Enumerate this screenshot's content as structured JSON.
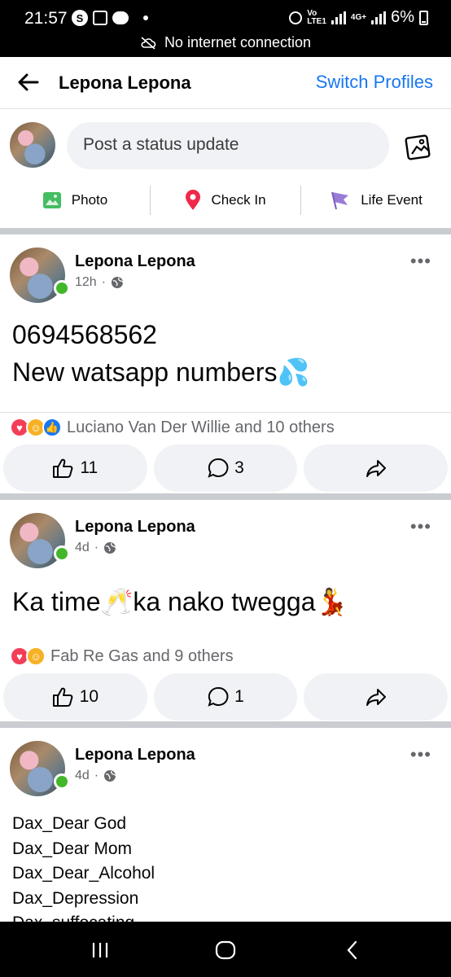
{
  "status_bar": {
    "time": "21:57",
    "s_icon": "S",
    "battery": "6%",
    "carrier_volte": "Vo\nLTE1",
    "carrier_4g": "4G+",
    "network_message": "No internet connection"
  },
  "header": {
    "title": "Lepona Lepona",
    "switch_label": "Switch Profiles"
  },
  "composer": {
    "placeholder": "Post a status update",
    "actions": [
      {
        "label": "Photo",
        "icon": "photo-icon",
        "color": "#45bd62"
      },
      {
        "label": "Check In",
        "icon": "location-pin-icon",
        "color": "#f02849"
      },
      {
        "label": "Life Event",
        "icon": "flag-icon",
        "color": "#9a7bd7"
      }
    ]
  },
  "posts": [
    {
      "author": "Lepona Lepona",
      "time": "12h",
      "dot": "·",
      "lines": [
        "0694568562",
        "New watsapp numbers💦"
      ],
      "reactions_text": "Luciano Van Der Willie and 10 others",
      "likes": "11",
      "comments": "3"
    },
    {
      "author": "Lepona Lepona",
      "time": "4d",
      "dot": "·",
      "lines": [
        "Ka time🥂ka nako twegga💃"
      ],
      "reactions_text": "Fab Re Gas and 9 others",
      "likes": "10",
      "comments": "1"
    },
    {
      "author": "Lepona Lepona",
      "time": "4d",
      "dot": "·",
      "lines": [
        "Dax_Dear God",
        "Dax_Dear Mom",
        "Dax_Dear_Alcohol",
        "Dax_Depression",
        "Dax_suffocating"
      ]
    }
  ],
  "colors": {
    "brand_blue": "#1877f2",
    "online_green": "#42b72a",
    "love": "#f33e58",
    "care": "#f7b125"
  }
}
